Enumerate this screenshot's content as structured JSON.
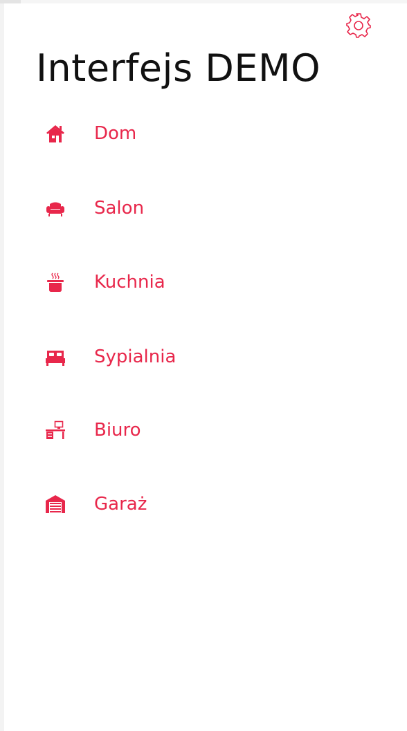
{
  "app": {
    "title": "Interfejs DEMO"
  },
  "accent_color": "#e8274b",
  "settings": {
    "icon": "gear-icon"
  },
  "menu": {
    "items": [
      {
        "label": "Dom",
        "icon": "house-icon"
      },
      {
        "label": "Salon",
        "icon": "armchair-icon"
      },
      {
        "label": "Kuchnia",
        "icon": "cooking-pot-icon"
      },
      {
        "label": "Sypialnia",
        "icon": "bed-icon"
      },
      {
        "label": "Biuro",
        "icon": "desk-icon"
      },
      {
        "label": "Garaż",
        "icon": "garage-icon"
      }
    ]
  }
}
